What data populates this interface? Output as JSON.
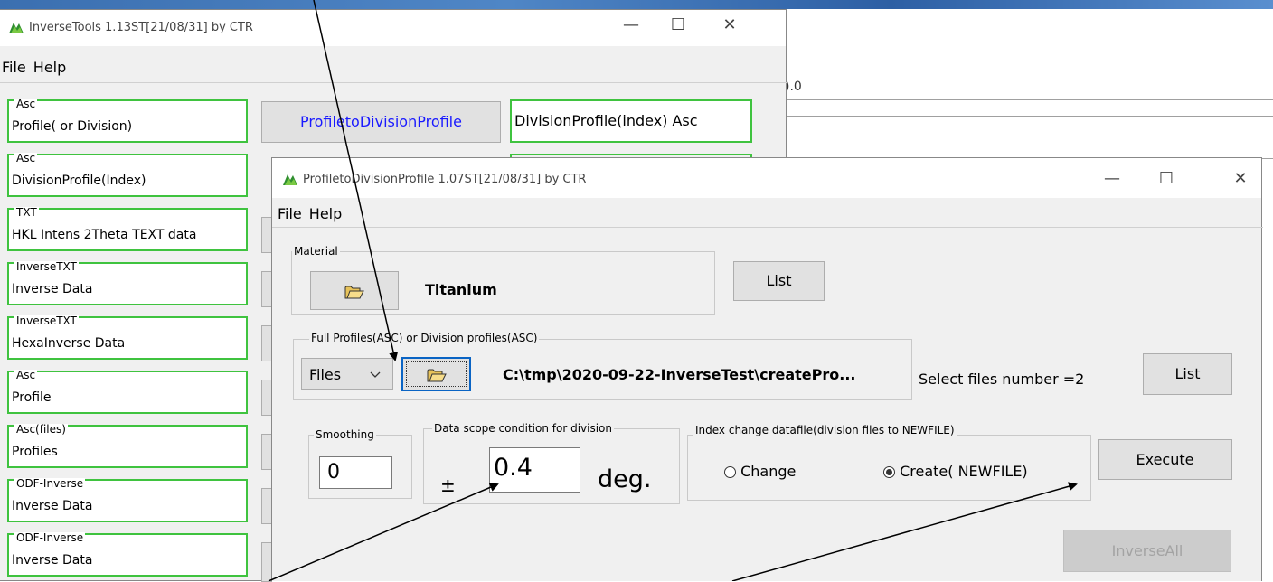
{
  "back_window": {
    "title": "InverseTools 1.13ST[21/08/31] by CTR",
    "menu": [
      "File",
      "Help"
    ],
    "bg_fragment": ").0",
    "groups": [
      {
        "caption": "Asc",
        "value": "Profile( or Division)"
      },
      {
        "caption": "Asc",
        "value": "DivisionProfile(Index)"
      },
      {
        "caption": "TXT",
        "value": "HKL Intens 2Theta TEXT data"
      },
      {
        "caption": "InverseTXT",
        "value": "Inverse Data"
      },
      {
        "caption": "InverseTXT",
        "value": "HexaInverse Data"
      },
      {
        "caption": "Asc",
        "value": "Profile"
      },
      {
        "caption": "Asc(files)",
        "value": "Profiles"
      },
      {
        "caption": "ODF-Inverse",
        "value": "Inverse Data"
      },
      {
        "caption": "ODF-Inverse",
        "value": "Inverse Data"
      }
    ],
    "profile_button": "ProfiletoDivisionProfile",
    "division_box": "DivisionProfile(index) Asc"
  },
  "front_window": {
    "title": "ProfiletoDivisionProfile 1.07ST[21/08/31] by CTR",
    "menu": [
      "File",
      "Help"
    ],
    "material": {
      "caption": "Material",
      "name": "Titanium",
      "list_label": "List"
    },
    "profiles": {
      "caption": "Full Profiles(ASC) or Division profiles(ASC)",
      "mode": "Files",
      "path": "C:\\tmp\\2020-09-22-InverseTest\\createPro...",
      "selected_text": "Select files number =2",
      "list_label": "List"
    },
    "smoothing": {
      "caption": "Smoothing",
      "value": "0"
    },
    "scope": {
      "caption": "Data scope condition for division",
      "pm": "±",
      "value": "0.4",
      "unit": "deg."
    },
    "index_change": {
      "caption": "Index change datafile(division files to NEWFILE)",
      "options": [
        "Change",
        "Create( NEWFILE)"
      ],
      "selected": 1
    },
    "execute_label": "Execute",
    "inverse_all_label": "InverseAll"
  },
  "colors": {
    "green_border": "#3fc33f",
    "link_blue": "#1a1aff",
    "icon_green": "#2f8f2f"
  }
}
